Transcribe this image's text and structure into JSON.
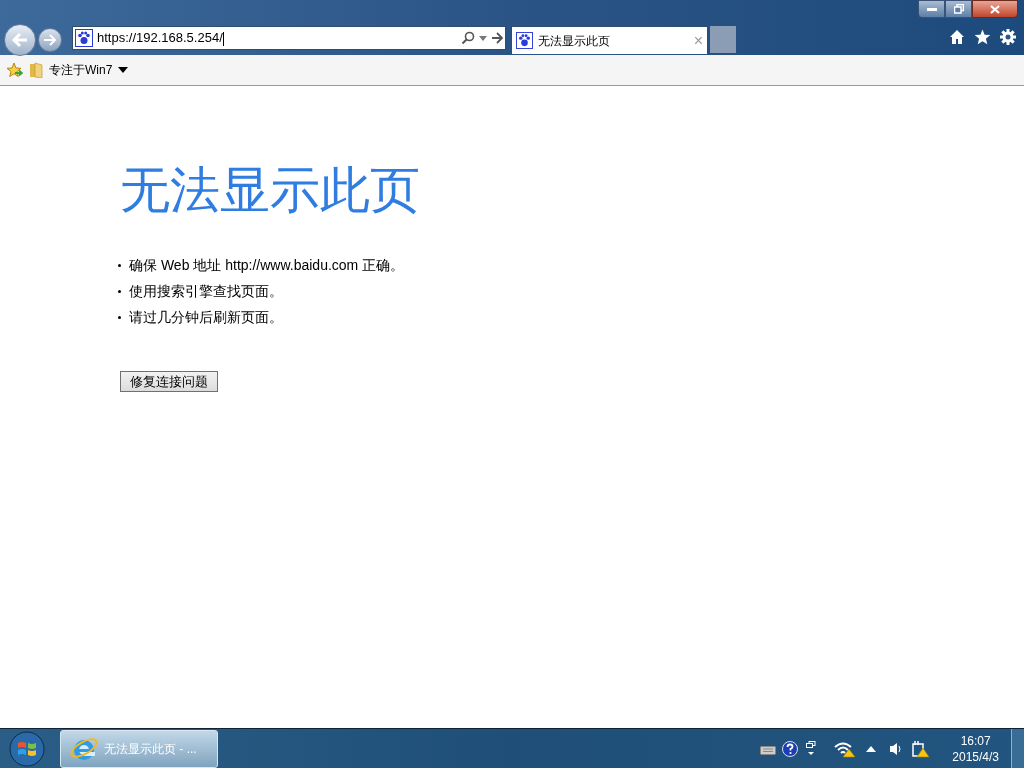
{
  "address_bar": {
    "value": "https://192.168.5.254/"
  },
  "tabs": [
    {
      "label": "无法显示此页",
      "selected": true,
      "close": "×"
    }
  ],
  "favorites_bar": {
    "folders": [
      {
        "label": "专注于Win7"
      }
    ]
  },
  "page": {
    "heading": "无法显示此页",
    "bullets": [
      "确保 Web 地址 http://www.baidu.com 正确。",
      "使用搜索引擎查找页面。",
      "请过几分钟后刷新页面。"
    ],
    "button": "修复连接问题"
  },
  "taskbar": {
    "items": [
      {
        "label": "无法显示此页 - ...",
        "selected": true
      }
    ],
    "clock": {
      "time": "16:07",
      "date": "2015/4/3"
    }
  }
}
